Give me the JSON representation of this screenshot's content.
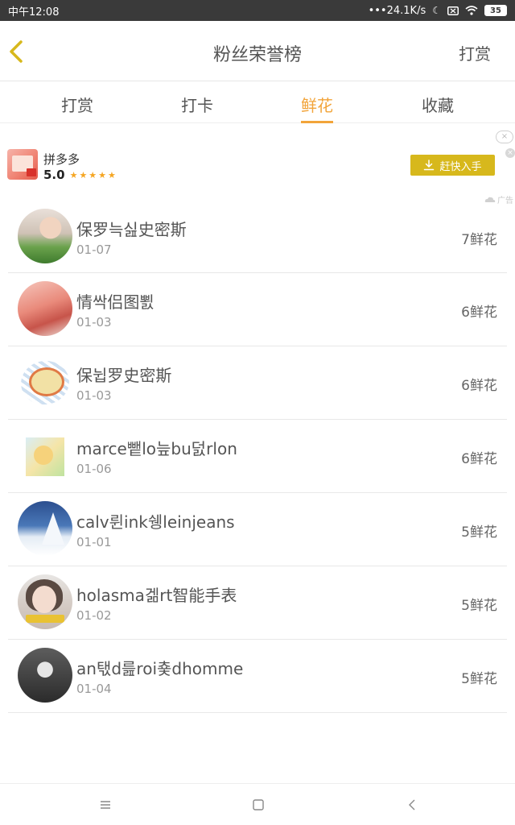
{
  "status_bar": {
    "time": "中午12:08",
    "network_speed": "•••24.1K/s",
    "battery": "35",
    "icons": [
      "moon-icon",
      "sim-icon",
      "wifi-icon",
      "battery-icon"
    ]
  },
  "header": {
    "title": "粉丝荣誉榜",
    "action_label": "打赏",
    "back_icon": "chevron-left-icon"
  },
  "tabs": [
    {
      "label": "打赏",
      "active": false
    },
    {
      "label": "打卡",
      "active": false
    },
    {
      "label": "鲜花",
      "active": true
    },
    {
      "label": "收藏",
      "active": false
    }
  ],
  "ad": {
    "app_name": "拼多多",
    "rating": "5.0",
    "stars": "★★★★★",
    "cta_label": "赶快入手",
    "ad_tag": "广告",
    "close_glyph": "×"
  },
  "list": [
    {
      "name": "保罗늑싪史密斯",
      "date": "01-07",
      "count": "7鲜花"
    },
    {
      "name": "情싹侣图뾠",
      "date": "01-03",
      "count": "6鲜花"
    },
    {
      "name": "保뉩罗史密斯",
      "date": "01-03",
      "count": "6鲜花"
    },
    {
      "name": "marce뺕lo늪bu덠rlon",
      "date": "01-06",
      "count": "6鲜花"
    },
    {
      "name": "calv륀ink쉥leinjeans",
      "date": "01-01",
      "count": "5鲜花"
    },
    {
      "name": "holasma겖rt智能手表",
      "date": "01-02",
      "count": "5鲜花"
    },
    {
      "name": "an탟d릂roi춏dhomme",
      "date": "01-04",
      "count": "5鲜花"
    }
  ],
  "nav": {
    "menu_icon": "menu-icon",
    "home_icon": "square-home-icon",
    "back_icon": "back-triangle-icon"
  },
  "colors": {
    "accent": "#f2a43a",
    "cta": "#d7b81c",
    "status_bar": "#3a3a3a"
  }
}
